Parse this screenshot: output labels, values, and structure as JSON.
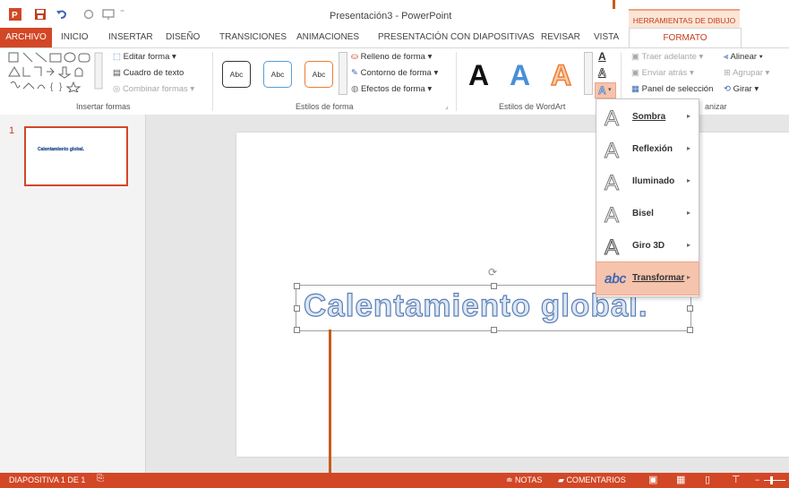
{
  "window": {
    "title": "Presentación3 - PowerPoint"
  },
  "contextual": {
    "group_label": "HERRAMIENTAS DE DIBUJO",
    "tab_label": "FORMATO"
  },
  "tabs": [
    "ARCHIVO",
    "INICIO",
    "INSERTAR",
    "DISEÑO",
    "TRANSICIONES",
    "ANIMACIONES",
    "PRESENTACIÓN CON DIAPOSITIVAS",
    "REVISAR",
    "VISTA"
  ],
  "ribbon": {
    "insert_shapes": {
      "label": "Insertar formas",
      "edit_shape": "Editar forma",
      "text_box": "Cuadro de texto",
      "merge_shapes": "Combinar formas"
    },
    "shape_styles": {
      "label": "Estilos de forma",
      "style_sample": "Abc",
      "fill": "Relleno de forma",
      "outline": "Contorno de forma",
      "effects": "Efectos de forma"
    },
    "wordart_styles": {
      "label": "Estilos de WordArt",
      "sample": "A"
    },
    "arrange": {
      "label": "anizar",
      "bring_forward": "Traer adelante",
      "send_backward": "Enviar atrás",
      "selection_pane": "Panel de selección",
      "align": "Alinear",
      "group": "Agrupar",
      "rotate": "Girar"
    }
  },
  "thumbnail": {
    "number": "1",
    "text": "Calentamiento global."
  },
  "slide": {
    "text": "Calentamiento global."
  },
  "text_effects_menu": {
    "items": [
      {
        "label": "Sombra",
        "icon": "A"
      },
      {
        "label": "Reflexión",
        "icon": "A"
      },
      {
        "label": "Iluminado",
        "icon": "A"
      },
      {
        "label": "Bisel",
        "icon": "A"
      },
      {
        "label": "Giro 3D",
        "icon": "A"
      },
      {
        "label": "Transformar",
        "icon": "abc"
      }
    ]
  },
  "statusbar": {
    "slide_info": "DIAPOSITIVA 1 DE 1",
    "notes": "NOTAS",
    "comments": "COMENTARIOS"
  },
  "colors": {
    "accent": "#d24726",
    "callout": "#c75b1c",
    "menu_active": "#f6c3ad"
  }
}
